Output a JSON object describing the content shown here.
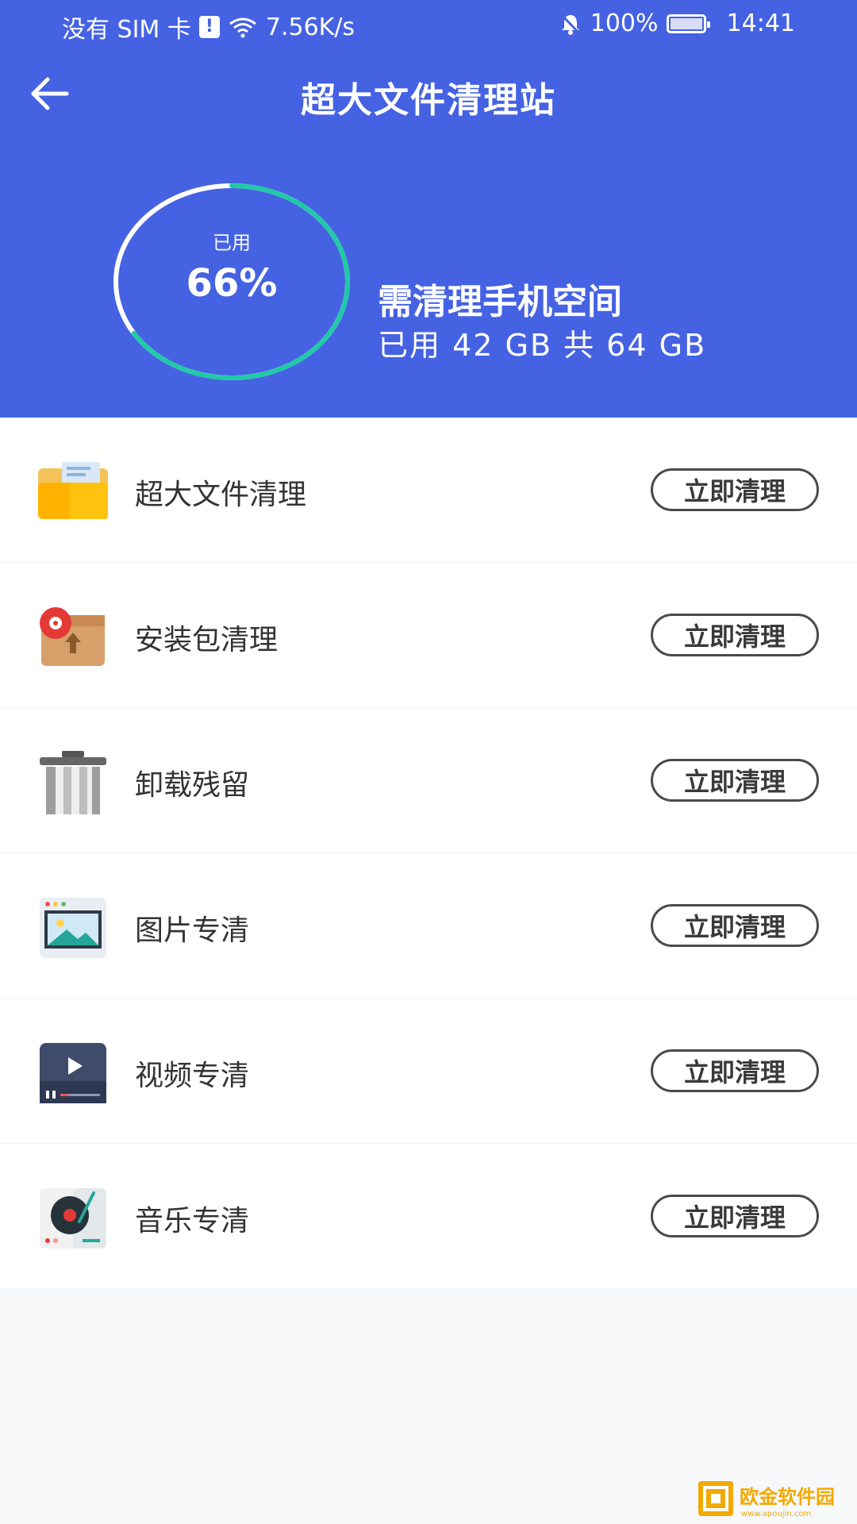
{
  "status": {
    "carrier": "没有 SIM 卡",
    "net_speed": "7.56K/s",
    "battery": "100%",
    "time": "14:41"
  },
  "header": {
    "title": "超大文件清理站",
    "ring_label": "已用",
    "used_percent_text": "66%",
    "used_fraction": 0.66,
    "space_title": "需清理手机空间",
    "space_detail": "已用 42 GB  共 64 GB"
  },
  "colors": {
    "primary": "#4562e3",
    "ring_accent": "#22c9a6",
    "ring_base": "#ffffff",
    "button_border": "#4a4a4a"
  },
  "items": [
    {
      "label": "超大文件清理",
      "button": "立即清理",
      "icon": "folder-icon"
    },
    {
      "label": "安装包清理",
      "button": "立即清理",
      "icon": "package-icon"
    },
    {
      "label": "卸载残留",
      "button": "立即清理",
      "icon": "trash-icon"
    },
    {
      "label": "图片专清",
      "button": "立即清理",
      "icon": "image-icon"
    },
    {
      "label": "视频专清",
      "button": "立即清理",
      "icon": "video-icon"
    },
    {
      "label": "音乐专清",
      "button": "立即清理",
      "icon": "music-icon"
    }
  ],
  "watermark": {
    "text": "欧金软件园",
    "url_text": "www.apoujin.com"
  }
}
